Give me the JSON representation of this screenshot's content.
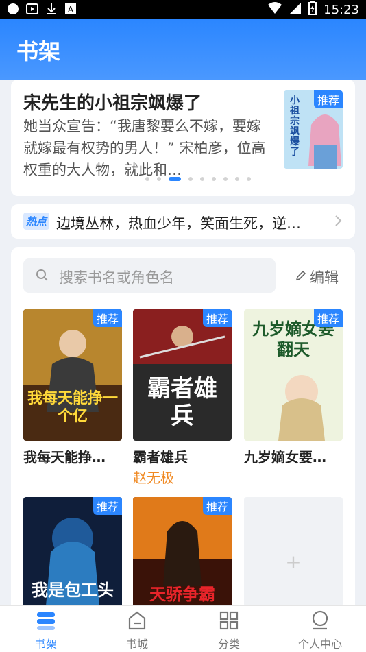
{
  "status_bar": {
    "time": "15:23"
  },
  "header": {
    "title": "书架"
  },
  "recommend": {
    "title": "宋先生的小祖宗飒爆了",
    "description": "她当众宣告：“我唐黎要么不嫁，要嫁就嫁最有权势的男人！” 宋柏彦，位高权重的大人物，就此和…",
    "badge": "推荐",
    "cover_title": "小祖宗飒爆了",
    "carousel_active_index": 2,
    "carousel_count": 9
  },
  "hot": {
    "tag": "热点",
    "text": "边境丛林，热血少年，笑面生死，逆…"
  },
  "shelf": {
    "search_placeholder": "搜索书名或角色名",
    "edit_label": "编辑",
    "books": [
      {
        "name": "我每天能挣…",
        "author": "",
        "badge": "推荐",
        "cover_title": "我每天能挣一个亿"
      },
      {
        "name": "霸者雄兵",
        "author": "赵无极",
        "badge": "推荐",
        "cover_title": "霸者雄兵"
      },
      {
        "name": "九岁嫡女要…",
        "author": "",
        "badge": "推荐",
        "cover_title": "九岁嫡女要翻天"
      },
      {
        "name": "",
        "author": "",
        "badge": "推荐",
        "cover_title": "我是包工头"
      },
      {
        "name": "",
        "author": "",
        "badge": "推荐",
        "cover_title": "天骄争霸"
      }
    ],
    "add_label": "+"
  },
  "nav": {
    "items": [
      {
        "label": "书架",
        "icon": "bookshelf-icon",
        "active": true
      },
      {
        "label": "书城",
        "icon": "store-icon",
        "active": false
      },
      {
        "label": "分类",
        "icon": "grid-icon",
        "active": false
      },
      {
        "label": "个人中心",
        "icon": "profile-icon",
        "active": false
      }
    ]
  },
  "colors": {
    "accent": "#2b86ff",
    "author": "#f08a24"
  }
}
